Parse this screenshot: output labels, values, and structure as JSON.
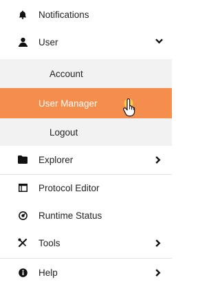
{
  "menu": {
    "notifications": {
      "label": "Notifications",
      "icon": "bell-icon"
    },
    "user": {
      "label": "User",
      "icon": "user-icon",
      "expanded": true
    },
    "user_sub": [
      {
        "label": "Account"
      },
      {
        "label": "User Manager",
        "active": true
      },
      {
        "label": "Logout"
      }
    ],
    "explorer": {
      "label": "Explorer",
      "icon": "folder-icon"
    },
    "protocol_editor": {
      "label": "Protocol Editor",
      "icon": "window-icon"
    },
    "runtime_status": {
      "label": "Runtime Status",
      "icon": "gauge-icon"
    },
    "tools": {
      "label": "Tools",
      "icon": "tools-icon"
    },
    "help": {
      "label": "Help",
      "icon": "info-icon"
    }
  },
  "colors": {
    "active_bg": "#f58d4c",
    "submenu_bg": "#f2f2f2",
    "divider": "#e2e2e2"
  }
}
